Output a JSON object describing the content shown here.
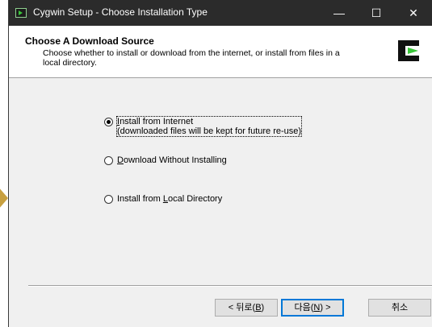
{
  "window": {
    "title": "Cygwin Setup - Choose Installation Type",
    "controls": {
      "minimize": "—",
      "maximize": "☐",
      "close": "✕"
    }
  },
  "header": {
    "title": "Choose A Download Source",
    "description": "Choose whether to install or download from the internet, or install from files in a local directory."
  },
  "options": [
    {
      "label_pre": "",
      "label_key": "I",
      "label_post": "nstall from Internet",
      "sublabel": "(downloaded files will be kept for future re-use)",
      "selected": true
    },
    {
      "label_pre": "",
      "label_key": "D",
      "label_post": "ownload Without Installing",
      "selected": false
    },
    {
      "label_pre": "Install from ",
      "label_key": "L",
      "label_post": "ocal Directory",
      "selected": false
    }
  ],
  "buttons": {
    "back_pre": "< 뒤로(",
    "back_key": "B",
    "back_post": ")",
    "next_pre": "다음(",
    "next_key": "N",
    "next_post": ") >",
    "cancel": "취소"
  },
  "colors": {
    "titlebar": "#2b2b2b",
    "accent": "#0078d7",
    "logo_green": "#39c639"
  }
}
